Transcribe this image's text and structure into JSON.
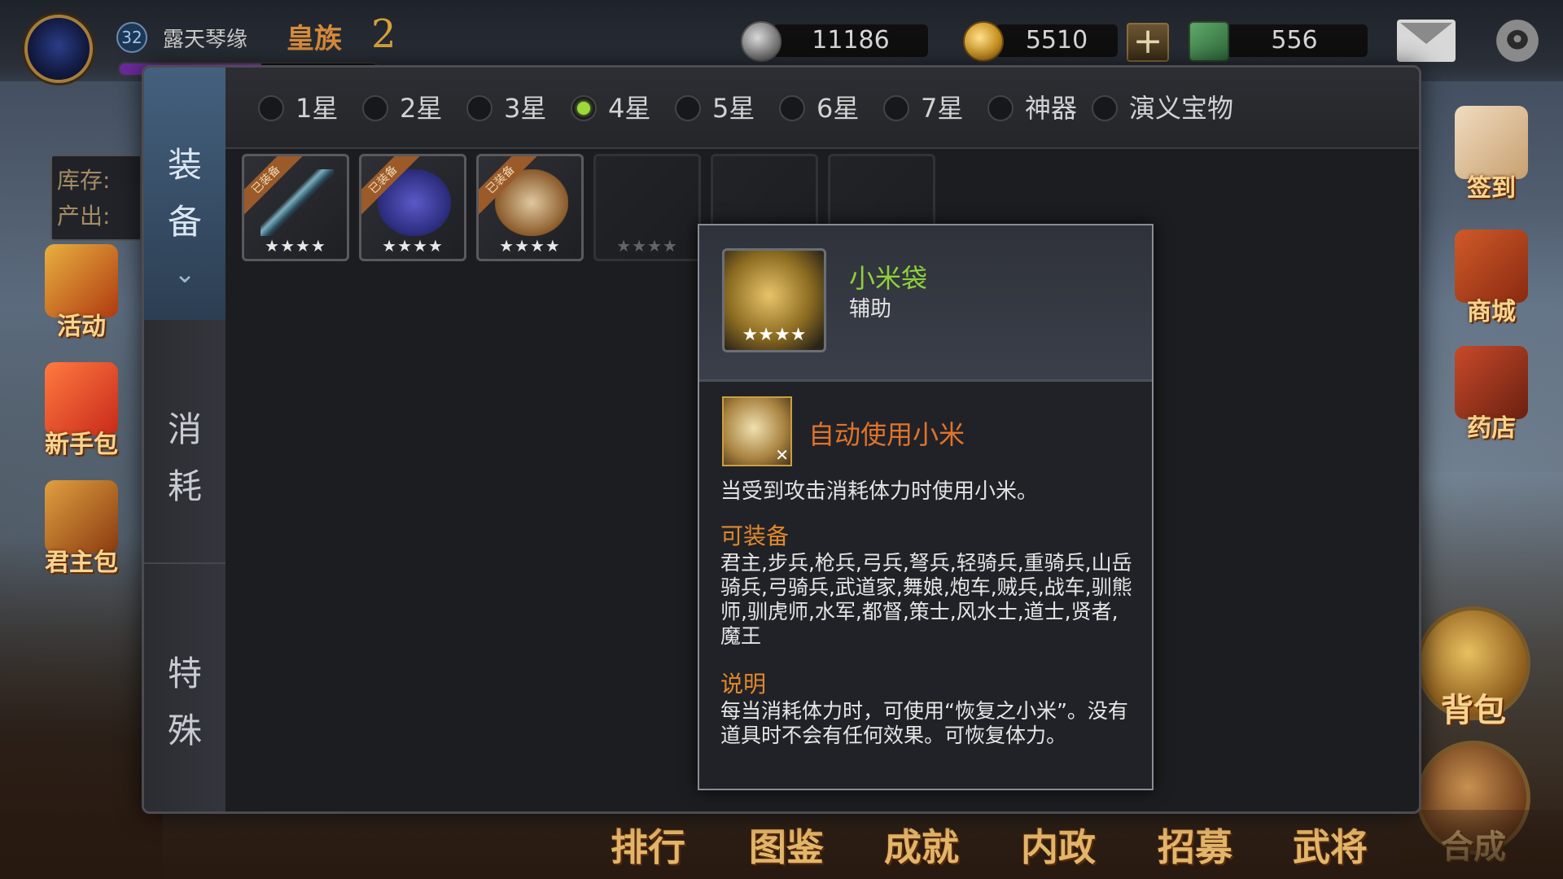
{
  "player": {
    "level": "32",
    "name": "露天琴缘",
    "rank_label": "皇族",
    "rank_value": "2",
    "xp_progress": 0.55
  },
  "currencies": {
    "silver": "11186",
    "gold": "5510",
    "jade": "556",
    "plus_label": "+"
  },
  "side_left": {
    "stock_label": "库存:",
    "output_label": "产出:",
    "activity_label": "活动",
    "newbie_pack_label": "新手包",
    "lord_pack_label": "君主包"
  },
  "side_right": {
    "signin_label": "签到",
    "mall_label": "商城",
    "pharmacy_label": "药店",
    "backpack_label": "背包",
    "synthesis_label": "合成"
  },
  "bottom_nav": [
    "排行",
    "图鉴",
    "成就",
    "内政",
    "招募",
    "武将"
  ],
  "modal": {
    "tabs": {
      "equip": [
        "装",
        "备"
      ],
      "consume": [
        "消",
        "耗"
      ],
      "special": [
        "特",
        "殊"
      ]
    },
    "filters": [
      {
        "label": "1星",
        "checked": false
      },
      {
        "label": "2星",
        "checked": false
      },
      {
        "label": "3星",
        "checked": false
      },
      {
        "label": "4星",
        "checked": true
      },
      {
        "label": "5星",
        "checked": false
      },
      {
        "label": "6星",
        "checked": false
      },
      {
        "label": "7星",
        "checked": false
      },
      {
        "label": "神器",
        "checked": false
      },
      {
        "label": "演义宝物",
        "checked": false
      }
    ],
    "items": [
      {
        "ribbon": "已装备",
        "stars": "★★★★",
        "icon": "sword-icon"
      },
      {
        "ribbon": "已装备",
        "stars": "★★★★",
        "icon": "robe-icon"
      },
      {
        "ribbon": "已装备",
        "stars": "★★★★",
        "icon": "cloak-icon"
      },
      {
        "ribbon": "",
        "stars": "★★★★",
        "icon": "item-icon"
      },
      {
        "ribbon": "",
        "stars": "★★★★",
        "icon": "item-icon"
      },
      {
        "ribbon": "",
        "stars": "★★★★",
        "icon": "item-icon"
      }
    ]
  },
  "tooltip": {
    "stars": "★★★★",
    "name": "小米袋",
    "type": "辅助",
    "skill_name": "自动使用小米",
    "skill_desc": "当受到攻击消耗体力时使用小米。",
    "equip_title": "可装备",
    "equip_body": "君主,步兵,枪兵,弓兵,弩兵,轻骑兵,重骑兵,山岳骑兵,弓骑兵,武道家,舞娘,炮车,贼兵,战车,驯熊师,驯虎师,水军,都督,策士,风水士,道士,贤者,魔王",
    "desc_title": "说明",
    "desc_body": "每当消耗体力时，可使用“恢复之小米”。没有道具时不会有任何效果。可恢复体力。"
  },
  "colors": {
    "accent_green": "#9ed83a",
    "item_name_green": "#8fd13a",
    "section_orange": "#e0892a"
  }
}
